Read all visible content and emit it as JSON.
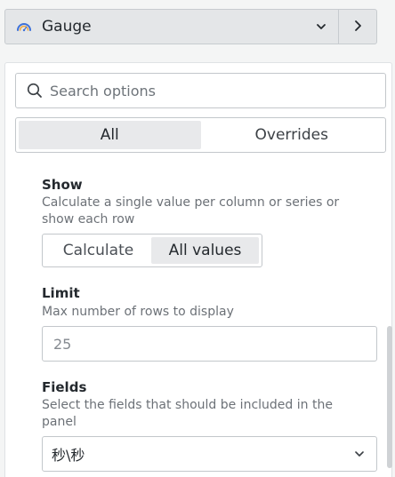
{
  "viz_picker": {
    "name": "Gauge",
    "icon": "gauge-icon"
  },
  "collapse_button": {
    "icon": "chevron-right-icon"
  },
  "search": {
    "placeholder": "Search options",
    "icon": "search-icon"
  },
  "tabs": [
    {
      "label": "All",
      "active": true
    },
    {
      "label": "Overrides",
      "active": false
    }
  ],
  "show": {
    "label": "Show",
    "description": "Calculate a single value per column or series or show each row",
    "options": [
      {
        "label": "Calculate",
        "selected": false
      },
      {
        "label": "All values",
        "selected": true
      }
    ]
  },
  "limit": {
    "label": "Limit",
    "description": "Max number of rows to display",
    "value": "",
    "placeholder": "25"
  },
  "fields": {
    "label": "Fields",
    "description": "Select the fields that should be included in the panel",
    "selected_value": "秒\\秒",
    "chevron_icon": "chevron-down-icon"
  }
}
